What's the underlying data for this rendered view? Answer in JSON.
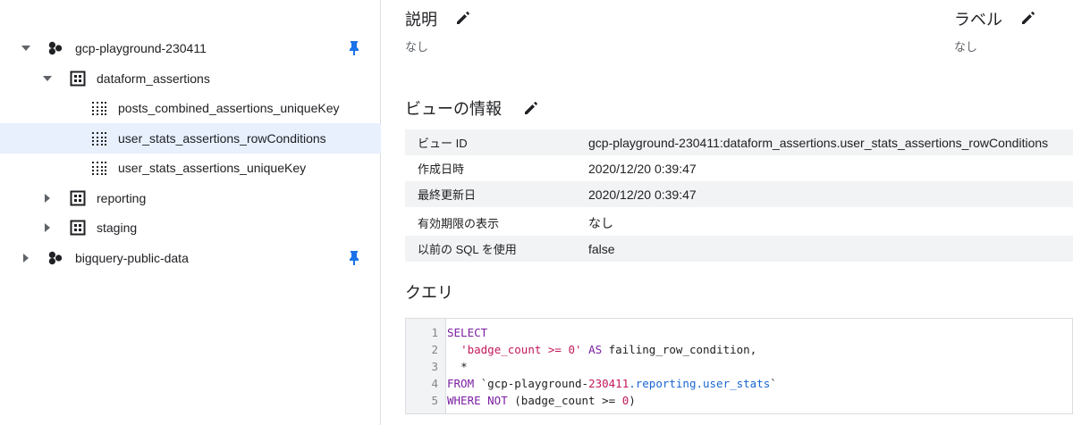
{
  "sidebar": {
    "projects": [
      {
        "name": "gcp-playground-230411"
      },
      {
        "name": "bigquery-public-data"
      }
    ],
    "datasets": [
      {
        "name": "dataform_assertions"
      },
      {
        "name": "reporting"
      },
      {
        "name": "staging"
      }
    ],
    "views": [
      {
        "name": "posts_combined_assertions_uniqueKey"
      },
      {
        "name": "user_stats_assertions_rowConditions"
      },
      {
        "name": "user_stats_assertions_uniqueKey"
      }
    ]
  },
  "main": {
    "description": {
      "title": "説明",
      "value": "なし"
    },
    "labels": {
      "title": "ラベル",
      "value": "なし"
    },
    "view_info": {
      "title": "ビューの情報",
      "rows": [
        {
          "key": "ビュー ID",
          "value": "gcp-playground-230411:dataform_assertions.user_stats_assertions_rowConditions"
        },
        {
          "key": "作成日時",
          "value": "2020/12/20 0:39:47"
        },
        {
          "key": "最終更新日",
          "value": "2020/12/20 0:39:47"
        },
        {
          "key": "有効期限の表示",
          "value": "なし"
        },
        {
          "key": "以前の SQL を使用",
          "value": "false"
        }
      ]
    },
    "query": {
      "title": "クエリ",
      "line_numbers": [
        "1",
        "2",
        "3",
        "4",
        "5"
      ],
      "l1_kw": "SELECT",
      "l2_str": "'badge_count >= 0'",
      "l2_kw": "AS",
      "l2_rest": "failing_row_condition,",
      "l3": "*",
      "l4_kw": "FROM",
      "l4_tick": "`",
      "l4_proj": "gcp-playground-",
      "l4_num": "230411",
      "l4_tbl": ".reporting.user_stats",
      "l4_tick_end": "`",
      "l5_kw": "WHERE NOT",
      "l5_paren": "(badge_count >= ",
      "l5_num": "0",
      "l5_end": ")"
    }
  },
  "colors": {
    "accent": "#1a73e8",
    "selected_bg": "#e8f0fe",
    "keyword": "#7b1fa2",
    "string": "#c2185b",
    "table": "#1967d2"
  }
}
